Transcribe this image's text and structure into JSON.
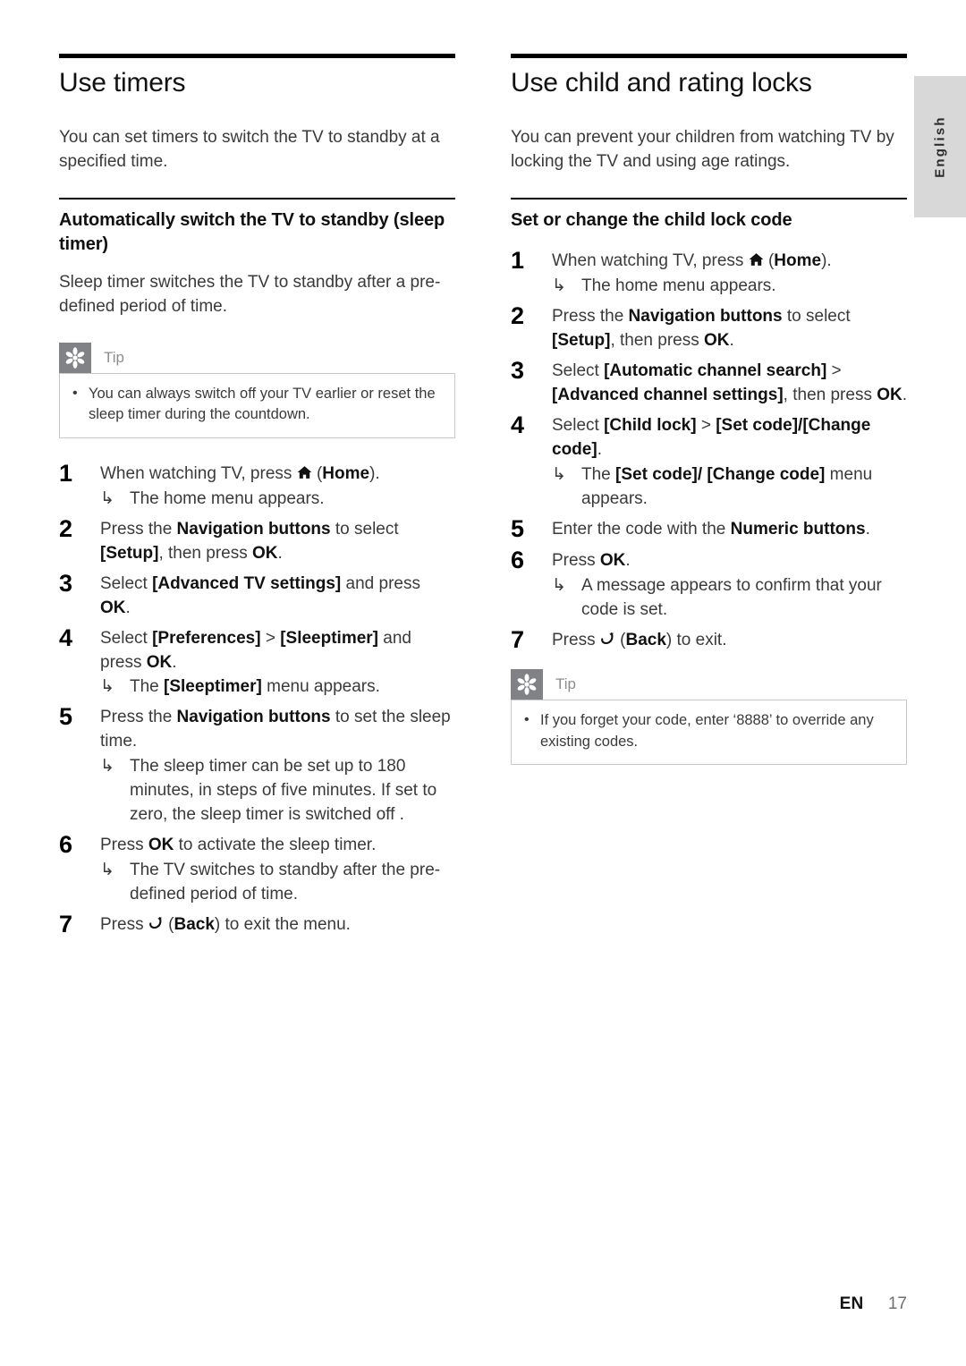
{
  "page": {
    "language_tab": "English",
    "footer_lang_code": "EN",
    "footer_page_number": "17"
  },
  "colors": {
    "rule": "#000000",
    "tip_icon_bg": "#808285",
    "tip_label": "#8d8d8d",
    "tip_border": "#c9c9c9",
    "lang_tab_bg": "#d8d8d8",
    "body_text": "#3a3a3a"
  },
  "left_column": {
    "title": "Use timers",
    "intro": "You can set timers to switch the TV to standby at a specified time.",
    "subsection": {
      "title": "Automatically switch the TV to standby (sleep timer)",
      "intro": "Sleep timer switches the TV to standby after a pre-defined period of time.",
      "tip": {
        "label": "Tip",
        "icon": "asterisk-flower-icon",
        "items": [
          "You can always switch off your TV earlier or reset the sleep timer during the countdown."
        ]
      },
      "steps": [
        {
          "number": "1",
          "text_parts": [
            {
              "t": "When watching TV, press ",
              "bold": false
            },
            {
              "t": "home-icon",
              "icon": true
            },
            {
              "t": " (",
              "bold": false
            },
            {
              "t": "Home",
              "bold": true
            },
            {
              "t": ").",
              "bold": false
            }
          ],
          "substeps": [
            {
              "arrow": "↳",
              "parts": [
                {
                  "t": "The home menu appears.",
                  "bold": false
                }
              ]
            }
          ]
        },
        {
          "number": "2",
          "text_parts": [
            {
              "t": "Press the ",
              "bold": false
            },
            {
              "t": "Navigation buttons",
              "bold": true
            },
            {
              "t": " to select ",
              "bold": false
            },
            {
              "t": "[Setup]",
              "bold": true
            },
            {
              "t": ", then press ",
              "bold": false
            },
            {
              "t": "OK",
              "bold": true
            },
            {
              "t": ".",
              "bold": false
            }
          ],
          "substeps": []
        },
        {
          "number": "3",
          "text_parts": [
            {
              "t": "Select ",
              "bold": false
            },
            {
              "t": "[Advanced TV settings]",
              "bold": true
            },
            {
              "t": " and press ",
              "bold": false
            },
            {
              "t": "OK",
              "bold": true
            },
            {
              "t": ".",
              "bold": false
            }
          ],
          "substeps": []
        },
        {
          "number": "4",
          "text_parts": [
            {
              "t": "Select ",
              "bold": false
            },
            {
              "t": "[Preferences]",
              "bold": true
            },
            {
              "t": " > ",
              "bold": false
            },
            {
              "t": "[Sleeptimer]",
              "bold": true
            },
            {
              "t": " and press ",
              "bold": false
            },
            {
              "t": "OK",
              "bold": true
            },
            {
              "t": ".",
              "bold": false
            }
          ],
          "substeps": [
            {
              "arrow": "↳",
              "parts": [
                {
                  "t": "The ",
                  "bold": false
                },
                {
                  "t": "[Sleeptimer]",
                  "bold": true
                },
                {
                  "t": " menu appears.",
                  "bold": false
                }
              ]
            }
          ]
        },
        {
          "number": "5",
          "text_parts": [
            {
              "t": "Press the ",
              "bold": false
            },
            {
              "t": "Navigation buttons",
              "bold": true
            },
            {
              "t": " to set the sleep time.",
              "bold": false
            }
          ],
          "substeps": [
            {
              "arrow": "↳",
              "parts": [
                {
                  "t": "The sleep timer can be set up to 180 minutes, in steps of five minutes. If set to zero, the sleep timer is switched off .",
                  "bold": false
                }
              ]
            }
          ]
        },
        {
          "number": "6",
          "text_parts": [
            {
              "t": "Press ",
              "bold": false
            },
            {
              "t": "OK",
              "bold": true
            },
            {
              "t": " to activate the sleep timer.",
              "bold": false
            }
          ],
          "substeps": [
            {
              "arrow": "↳",
              "parts": [
                {
                  "t": "The TV switches to standby after the pre-defined period of time.",
                  "bold": false
                }
              ]
            }
          ]
        },
        {
          "number": "7",
          "text_parts": [
            {
              "t": "Press ",
              "bold": false
            },
            {
              "t": "back-icon",
              "icon": true
            },
            {
              "t": " (",
              "bold": false
            },
            {
              "t": "Back",
              "bold": true
            },
            {
              "t": ") to exit the menu.",
              "bold": false
            }
          ],
          "substeps": []
        }
      ]
    }
  },
  "right_column": {
    "title": "Use child and rating locks",
    "intro": "You can prevent your children from watching TV by locking the TV and using age ratings.",
    "subsection": {
      "title": "Set or change the child lock code",
      "steps": [
        {
          "number": "1",
          "text_parts": [
            {
              "t": "When watching TV, press ",
              "bold": false
            },
            {
              "t": "home-icon",
              "icon": true
            },
            {
              "t": " (",
              "bold": false
            },
            {
              "t": "Home",
              "bold": true
            },
            {
              "t": ").",
              "bold": false
            }
          ],
          "substeps": [
            {
              "arrow": "↳",
              "parts": [
                {
                  "t": "The home menu appears.",
                  "bold": false
                }
              ]
            }
          ]
        },
        {
          "number": "2",
          "text_parts": [
            {
              "t": "Press the ",
              "bold": false
            },
            {
              "t": "Navigation buttons",
              "bold": true
            },
            {
              "t": " to select ",
              "bold": false
            },
            {
              "t": "[Setup]",
              "bold": true
            },
            {
              "t": ", then press ",
              "bold": false
            },
            {
              "t": "OK",
              "bold": true
            },
            {
              "t": ".",
              "bold": false
            }
          ],
          "substeps": []
        },
        {
          "number": "3",
          "text_parts": [
            {
              "t": "Select ",
              "bold": false
            },
            {
              "t": "[Automatic channel search]",
              "bold": true
            },
            {
              "t": " > ",
              "bold": false
            },
            {
              "t": "[Advanced channel settings]",
              "bold": true
            },
            {
              "t": ", then press ",
              "bold": false
            },
            {
              "t": "OK",
              "bold": true
            },
            {
              "t": ".",
              "bold": false
            }
          ],
          "substeps": []
        },
        {
          "number": "4",
          "text_parts": [
            {
              "t": "Select ",
              "bold": false
            },
            {
              "t": "[Child lock]",
              "bold": true
            },
            {
              "t": " > ",
              "bold": false
            },
            {
              "t": "[Set code]/[Change code]",
              "bold": true
            },
            {
              "t": ".",
              "bold": false
            }
          ],
          "substeps": [
            {
              "arrow": "↳",
              "parts": [
                {
                  "t": "The ",
                  "bold": false
                },
                {
                  "t": "[Set code]/ [Change code]",
                  "bold": true
                },
                {
                  "t": " menu appears.",
                  "bold": false
                }
              ]
            }
          ]
        },
        {
          "number": "5",
          "text_parts": [
            {
              "t": "Enter the code with the ",
              "bold": false
            },
            {
              "t": "Numeric buttons",
              "bold": true
            },
            {
              "t": ".",
              "bold": false
            }
          ],
          "substeps": []
        },
        {
          "number": "6",
          "text_parts": [
            {
              "t": "Press ",
              "bold": false
            },
            {
              "t": "OK",
              "bold": true
            },
            {
              "t": ".",
              "bold": false
            }
          ],
          "substeps": [
            {
              "arrow": "↳",
              "parts": [
                {
                  "t": "A message appears to confirm that your code is set.",
                  "bold": false
                }
              ]
            }
          ]
        },
        {
          "number": "7",
          "text_parts": [
            {
              "t": "Press ",
              "bold": false
            },
            {
              "t": "back-icon",
              "icon": true
            },
            {
              "t": " (",
              "bold": false
            },
            {
              "t": "Back",
              "bold": true
            },
            {
              "t": ") to exit.",
              "bold": false
            }
          ],
          "substeps": []
        }
      ],
      "tip": {
        "label": "Tip",
        "icon": "asterisk-flower-icon",
        "items": [
          "If you forget your code, enter ‘8888’ to override any existing codes."
        ]
      }
    }
  }
}
